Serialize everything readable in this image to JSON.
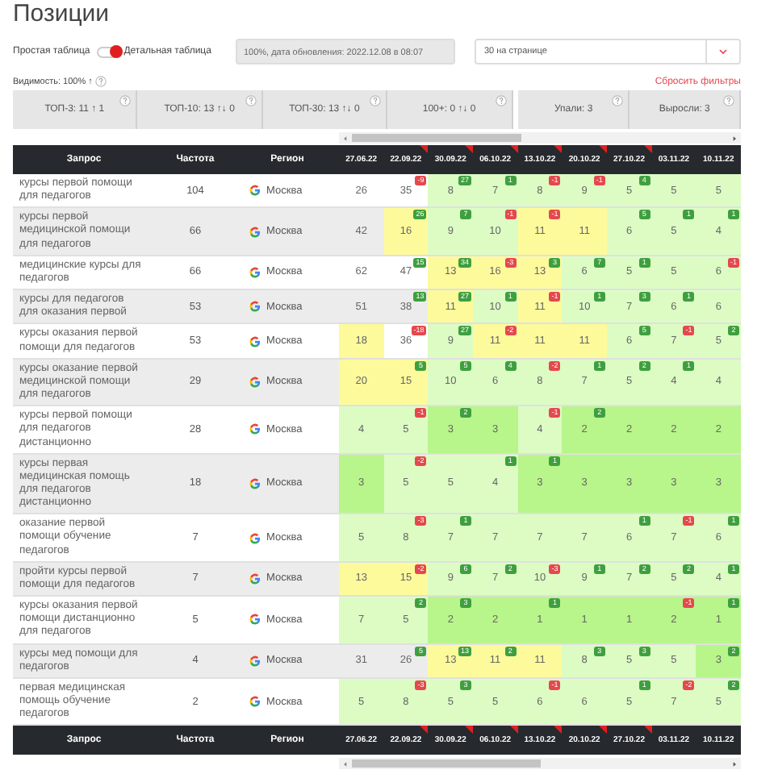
{
  "title": "Позиции",
  "view_toggle": {
    "left_label": "Простая таблица",
    "right_label": "Детальная таблица",
    "on": true
  },
  "update_info": "100%, дата обновления: 2022.12.08 в 08:07",
  "page_size": {
    "value": "30 на странице"
  },
  "visibility": "Видимость: 100% ↑",
  "reset_filters": "Сбросить фильтры",
  "position_stats": [
    "ТОП-3: 11 ↑ 1",
    "ТОП-10: 13 ↑↓ 0",
    "ТОП-30: 13 ↑↓ 0",
    "100+: 0 ↑↓ 0"
  ],
  "change_stats": [
    "Упали: 3",
    "Выросли: 3"
  ],
  "table": {
    "columns": [
      "Запрос",
      "Частота",
      "Регион"
    ],
    "dates": [
      {
        "label": "27.06.22",
        "flagged": false
      },
      {
        "label": "22.09.22",
        "flagged": true
      },
      {
        "label": "30.09.22",
        "flagged": true
      },
      {
        "label": "06.10.22",
        "flagged": true
      },
      {
        "label": "13.10.22",
        "flagged": true
      },
      {
        "label": "20.10.22",
        "flagged": true
      },
      {
        "label": "27.10.22",
        "flagged": true
      },
      {
        "label": "03.11.22",
        "flagged": false
      },
      {
        "label": "10.11.22",
        "flagged": false
      }
    ],
    "rows": [
      {
        "query": "курсы первой помощи для педагогов",
        "frequency": "104",
        "region": "Москва",
        "cells": [
          {
            "value": "26"
          },
          {
            "value": "35",
            "change": "-9",
            "improved": false
          },
          {
            "value": "8",
            "change": "27",
            "improved": true,
            "color": "#dcfcc4"
          },
          {
            "value": "7",
            "change": "1",
            "improved": true,
            "color": "#dcfcc4"
          },
          {
            "value": "8",
            "change": "-1",
            "improved": false,
            "color": "#dcfcc4"
          },
          {
            "value": "9",
            "change": "-1",
            "improved": false,
            "color": "#dcfcc4"
          },
          {
            "value": "5",
            "change": "4",
            "improved": true,
            "color": "#dcfcc4"
          },
          {
            "value": "5",
            "color": "#dcfcc4"
          },
          {
            "value": "5",
            "color": "#dcfcc4"
          }
        ]
      },
      {
        "query": "курсы первой медицинской помощи для педагогов",
        "frequency": "66",
        "region": "Москва",
        "cells": [
          {
            "value": "42"
          },
          {
            "value": "16",
            "change": "26",
            "improved": true,
            "color": "#fdfa9c"
          },
          {
            "value": "9",
            "change": "7",
            "improved": true,
            "color": "#dcfcc4"
          },
          {
            "value": "10",
            "change": "-1",
            "improved": false,
            "color": "#dcfcc4"
          },
          {
            "value": "11",
            "change": "-1",
            "improved": false,
            "color": "#fdfa9c"
          },
          {
            "value": "11",
            "color": "#fdfa9c"
          },
          {
            "value": "6",
            "change": "5",
            "improved": true,
            "color": "#dcfcc4"
          },
          {
            "value": "5",
            "change": "1",
            "improved": true,
            "color": "#dcfcc4"
          },
          {
            "value": "4",
            "change": "1",
            "improved": true,
            "color": "#dcfcc4"
          }
        ]
      },
      {
        "query": "медицинские курсы для педагогов",
        "frequency": "66",
        "region": "Москва",
        "cells": [
          {
            "value": "62"
          },
          {
            "value": "47",
            "change": "15",
            "improved": true
          },
          {
            "value": "13",
            "change": "34",
            "improved": true,
            "color": "#fdfa9c"
          },
          {
            "value": "16",
            "change": "-3",
            "improved": false,
            "color": "#fdfa9c"
          },
          {
            "value": "13",
            "change": "3",
            "improved": true,
            "color": "#fdfa9c"
          },
          {
            "value": "6",
            "change": "7",
            "improved": true,
            "color": "#dcfcc4"
          },
          {
            "value": "5",
            "change": "1",
            "improved": true,
            "color": "#dcfcc4"
          },
          {
            "value": "5",
            "color": "#dcfcc4"
          },
          {
            "value": "6",
            "change": "-1",
            "improved": false,
            "color": "#dcfcc4"
          }
        ]
      },
      {
        "query": "курсы для педагогов для оказания первой",
        "frequency": "53",
        "region": "Москва",
        "cells": [
          {
            "value": "51"
          },
          {
            "value": "38",
            "change": "13",
            "improved": true
          },
          {
            "value": "11",
            "change": "27",
            "improved": true,
            "color": "#fdfa9c"
          },
          {
            "value": "10",
            "change": "1",
            "improved": true,
            "color": "#dcfcc4"
          },
          {
            "value": "11",
            "change": "-1",
            "improved": false,
            "color": "#fdfa9c"
          },
          {
            "value": "10",
            "change": "1",
            "improved": true,
            "color": "#dcfcc4"
          },
          {
            "value": "7",
            "change": "3",
            "improved": true,
            "color": "#dcfcc4"
          },
          {
            "value": "6",
            "change": "1",
            "improved": true,
            "color": "#dcfcc4"
          },
          {
            "value": "6",
            "color": "#dcfcc4"
          }
        ]
      },
      {
        "query": "курсы оказания первой помощи для педагогов",
        "frequency": "53",
        "region": "Москва",
        "cells": [
          {
            "value": "18",
            "color": "#fdfa9c"
          },
          {
            "value": "36",
            "change": "-18",
            "improved": false
          },
          {
            "value": "9",
            "change": "27",
            "improved": true,
            "color": "#dcfcc4"
          },
          {
            "value": "11",
            "change": "-2",
            "improved": false,
            "color": "#fdfa9c"
          },
          {
            "value": "11",
            "color": "#fdfa9c"
          },
          {
            "value": "11",
            "color": "#fdfa9c"
          },
          {
            "value": "6",
            "change": "5",
            "improved": true,
            "color": "#dcfcc4"
          },
          {
            "value": "7",
            "change": "-1",
            "improved": false,
            "color": "#dcfcc4"
          },
          {
            "value": "5",
            "change": "2",
            "improved": true,
            "color": "#dcfcc4"
          }
        ]
      },
      {
        "query": "курсы оказание первой медицинской помощи для педагогов",
        "frequency": "29",
        "region": "Москва",
        "cells": [
          {
            "value": "20",
            "color": "#fdfa9c"
          },
          {
            "value": "15",
            "change": "5",
            "improved": true,
            "color": "#fdfa9c"
          },
          {
            "value": "10",
            "change": "5",
            "improved": true,
            "color": "#dcfcc4"
          },
          {
            "value": "6",
            "change": "4",
            "improved": true,
            "color": "#dcfcc4"
          },
          {
            "value": "8",
            "change": "-2",
            "improved": false,
            "color": "#dcfcc4"
          },
          {
            "value": "7",
            "change": "1",
            "improved": true,
            "color": "#dcfcc4"
          },
          {
            "value": "5",
            "change": "2",
            "improved": true,
            "color": "#dcfcc4"
          },
          {
            "value": "4",
            "change": "1",
            "improved": true,
            "color": "#dcfcc4"
          },
          {
            "value": "4",
            "color": "#dcfcc4"
          }
        ]
      },
      {
        "query": "курсы первой помощи для педагогов дистанционно",
        "frequency": "28",
        "region": "Москва",
        "cells": [
          {
            "value": "4",
            "color": "#dcfcc4"
          },
          {
            "value": "5",
            "change": "-1",
            "improved": false,
            "color": "#dcfcc4"
          },
          {
            "value": "3",
            "change": "2",
            "improved": true,
            "color": "#b8f58a"
          },
          {
            "value": "3",
            "color": "#b8f58a"
          },
          {
            "value": "4",
            "change": "-1",
            "improved": false,
            "color": "#dcfcc4"
          },
          {
            "value": "2",
            "change": "2",
            "improved": true,
            "color": "#b8f58a"
          },
          {
            "value": "2",
            "color": "#b8f58a"
          },
          {
            "value": "2",
            "color": "#b8f58a"
          },
          {
            "value": "2",
            "color": "#b8f58a"
          }
        ]
      },
      {
        "query": "курсы первая медицинская помощь для педагогов дистанционно",
        "frequency": "18",
        "region": "Москва",
        "cells": [
          {
            "value": "3",
            "color": "#b8f58a"
          },
          {
            "value": "5",
            "change": "-2",
            "improved": false,
            "color": "#dcfcc4"
          },
          {
            "value": "5",
            "color": "#dcfcc4"
          },
          {
            "value": "4",
            "change": "1",
            "improved": true,
            "color": "#dcfcc4"
          },
          {
            "value": "3",
            "change": "1",
            "improved": true,
            "color": "#b8f58a"
          },
          {
            "value": "3",
            "color": "#b8f58a"
          },
          {
            "value": "3",
            "color": "#b8f58a"
          },
          {
            "value": "3",
            "color": "#b8f58a"
          },
          {
            "value": "3",
            "color": "#b8f58a"
          }
        ]
      },
      {
        "query": "оказание первой помощи обучение педагогов",
        "frequency": "7",
        "region": "Москва",
        "cells": [
          {
            "value": "5",
            "color": "#dcfcc4"
          },
          {
            "value": "8",
            "change": "-3",
            "improved": false,
            "color": "#dcfcc4"
          },
          {
            "value": "7",
            "change": "1",
            "improved": true,
            "color": "#dcfcc4"
          },
          {
            "value": "7",
            "color": "#dcfcc4"
          },
          {
            "value": "7",
            "color": "#dcfcc4"
          },
          {
            "value": "7",
            "color": "#dcfcc4"
          },
          {
            "value": "6",
            "change": "1",
            "improved": true,
            "color": "#dcfcc4"
          },
          {
            "value": "7",
            "change": "-1",
            "improved": false,
            "color": "#dcfcc4"
          },
          {
            "value": "6",
            "change": "1",
            "improved": true,
            "color": "#dcfcc4"
          }
        ]
      },
      {
        "query": "пройти курсы первой помощи для педагогов",
        "frequency": "7",
        "region": "Москва",
        "cells": [
          {
            "value": "13",
            "color": "#fdfa9c"
          },
          {
            "value": "15",
            "change": "-2",
            "improved": false,
            "color": "#fdfa9c"
          },
          {
            "value": "9",
            "change": "6",
            "improved": true,
            "color": "#dcfcc4"
          },
          {
            "value": "7",
            "change": "2",
            "improved": true,
            "color": "#dcfcc4"
          },
          {
            "value": "10",
            "change": "-3",
            "improved": false,
            "color": "#dcfcc4"
          },
          {
            "value": "9",
            "change": "1",
            "improved": true,
            "color": "#dcfcc4"
          },
          {
            "value": "7",
            "change": "2",
            "improved": true,
            "color": "#dcfcc4"
          },
          {
            "value": "5",
            "change": "2",
            "improved": true,
            "color": "#dcfcc4"
          },
          {
            "value": "4",
            "change": "1",
            "improved": true,
            "color": "#dcfcc4"
          }
        ]
      },
      {
        "query": "курсы оказания первой помощи дистанционно для педагогов",
        "frequency": "5",
        "region": "Москва",
        "cells": [
          {
            "value": "7",
            "color": "#dcfcc4"
          },
          {
            "value": "5",
            "change": "2",
            "improved": true,
            "color": "#dcfcc4"
          },
          {
            "value": "2",
            "change": "3",
            "improved": true,
            "color": "#b8f58a"
          },
          {
            "value": "2",
            "color": "#b8f58a"
          },
          {
            "value": "1",
            "change": "1",
            "improved": true,
            "color": "#b8f58a"
          },
          {
            "value": "1",
            "color": "#b8f58a"
          },
          {
            "value": "1",
            "color": "#b8f58a"
          },
          {
            "value": "2",
            "change": "-1",
            "improved": false,
            "color": "#b8f58a"
          },
          {
            "value": "1",
            "change": "1",
            "improved": true,
            "color": "#b8f58a"
          }
        ]
      },
      {
        "query": "курсы мед помощи для педагогов",
        "frequency": "4",
        "region": "Москва",
        "cells": [
          {
            "value": "31"
          },
          {
            "value": "26",
            "change": "5",
            "improved": true
          },
          {
            "value": "13",
            "change": "13",
            "improved": true,
            "color": "#fdfa9c"
          },
          {
            "value": "11",
            "change": "2",
            "improved": true,
            "color": "#fdfa9c"
          },
          {
            "value": "11",
            "color": "#fdfa9c"
          },
          {
            "value": "8",
            "change": "3",
            "improved": true,
            "color": "#dcfcc4"
          },
          {
            "value": "5",
            "change": "3",
            "improved": true,
            "color": "#dcfcc4"
          },
          {
            "value": "5",
            "color": "#dcfcc4"
          },
          {
            "value": "3",
            "change": "2",
            "improved": true,
            "color": "#b8f58a"
          }
        ]
      },
      {
        "query": "первая медицинская помощь обучение педагогов",
        "frequency": "2",
        "region": "Москва",
        "cells": [
          {
            "value": "5",
            "color": "#dcfcc4"
          },
          {
            "value": "8",
            "change": "-3",
            "improved": false,
            "color": "#dcfcc4"
          },
          {
            "value": "5",
            "change": "3",
            "improved": true,
            "color": "#dcfcc4"
          },
          {
            "value": "5",
            "color": "#dcfcc4"
          },
          {
            "value": "6",
            "change": "-1",
            "improved": false,
            "color": "#dcfcc4"
          },
          {
            "value": "6",
            "color": "#dcfcc4"
          },
          {
            "value": "5",
            "change": "1",
            "improved": true,
            "color": "#dcfcc4"
          },
          {
            "value": "7",
            "change": "-2",
            "improved": false,
            "color": "#dcfcc4"
          },
          {
            "value": "5",
            "change": "2",
            "improved": true,
            "color": "#dcfcc4"
          }
        ]
      }
    ],
    "footer_columns": [
      "Запрос",
      "Частота",
      "Регион"
    ],
    "footer_dates": [
      {
        "label": "27.06.22",
        "flagged": false
      },
      {
        "label": "22.09.22",
        "flagged": true
      },
      {
        "label": "30.09.22",
        "flagged": true
      },
      {
        "label": "06.10.22",
        "flagged": true
      },
      {
        "label": "13.10.22",
        "flagged": true
      },
      {
        "label": "20.10.22",
        "flagged": true
      },
      {
        "label": "27.10.22",
        "flagged": true
      },
      {
        "label": "03.11.22",
        "flagged": false
      },
      {
        "label": "10.11.22",
        "flagged": false
      }
    ]
  }
}
